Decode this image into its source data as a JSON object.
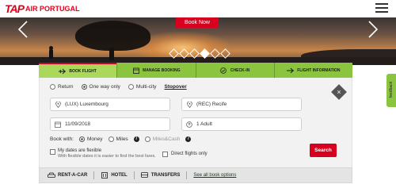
{
  "header": {
    "logo_mark": "TAP",
    "logo_text": "AIR PORTUGAL",
    "menu_icon": "hamburger-icon"
  },
  "hero": {
    "book_now_label": "Book Now",
    "prev_icon": "chevron-left-icon",
    "next_icon": "chevron-right-icon",
    "slide_count": 6,
    "active_slide": 4
  },
  "tabs": [
    {
      "label": "BOOK FLIGHT",
      "icon": "plane-icon"
    },
    {
      "label": "MANAGE BOOKING",
      "icon": "calendar-icon"
    },
    {
      "label": "CHECK-IN",
      "icon": "check-circle-icon"
    },
    {
      "label": "FLIGHT INFORMATION",
      "icon": "plane-info-icon"
    }
  ],
  "trip_type": {
    "options": [
      "Return",
      "One way only",
      "Multi-city"
    ],
    "selected": "One way only",
    "stopover_label": "Stopover"
  },
  "form": {
    "from_value": "(LUX) Luxembourg",
    "to_value": "(REC) Recife",
    "date_value": "11/09/2018",
    "passengers_value": "1 Adult",
    "book_with_label": "Book with:",
    "book_with_options": [
      "Money",
      "Miles",
      "Miles&Cash"
    ],
    "book_with_selected": "Money",
    "flexible_label": "My dates are flexible",
    "flexible_sub": "With flexible dates it is easier to find the best fares.",
    "direct_label": "Direct flights only",
    "search_label": "Search",
    "close_label": "×"
  },
  "services": {
    "rent_a_car": "RENT-A-CAR",
    "hotel": "HOTEL",
    "transfers": "TRANSFERS",
    "see_all": "See all book options"
  },
  "feedback": {
    "label": "feedback"
  },
  "colors": {
    "brand_red": "#d7001e",
    "brand_green": "#8bc53f"
  }
}
